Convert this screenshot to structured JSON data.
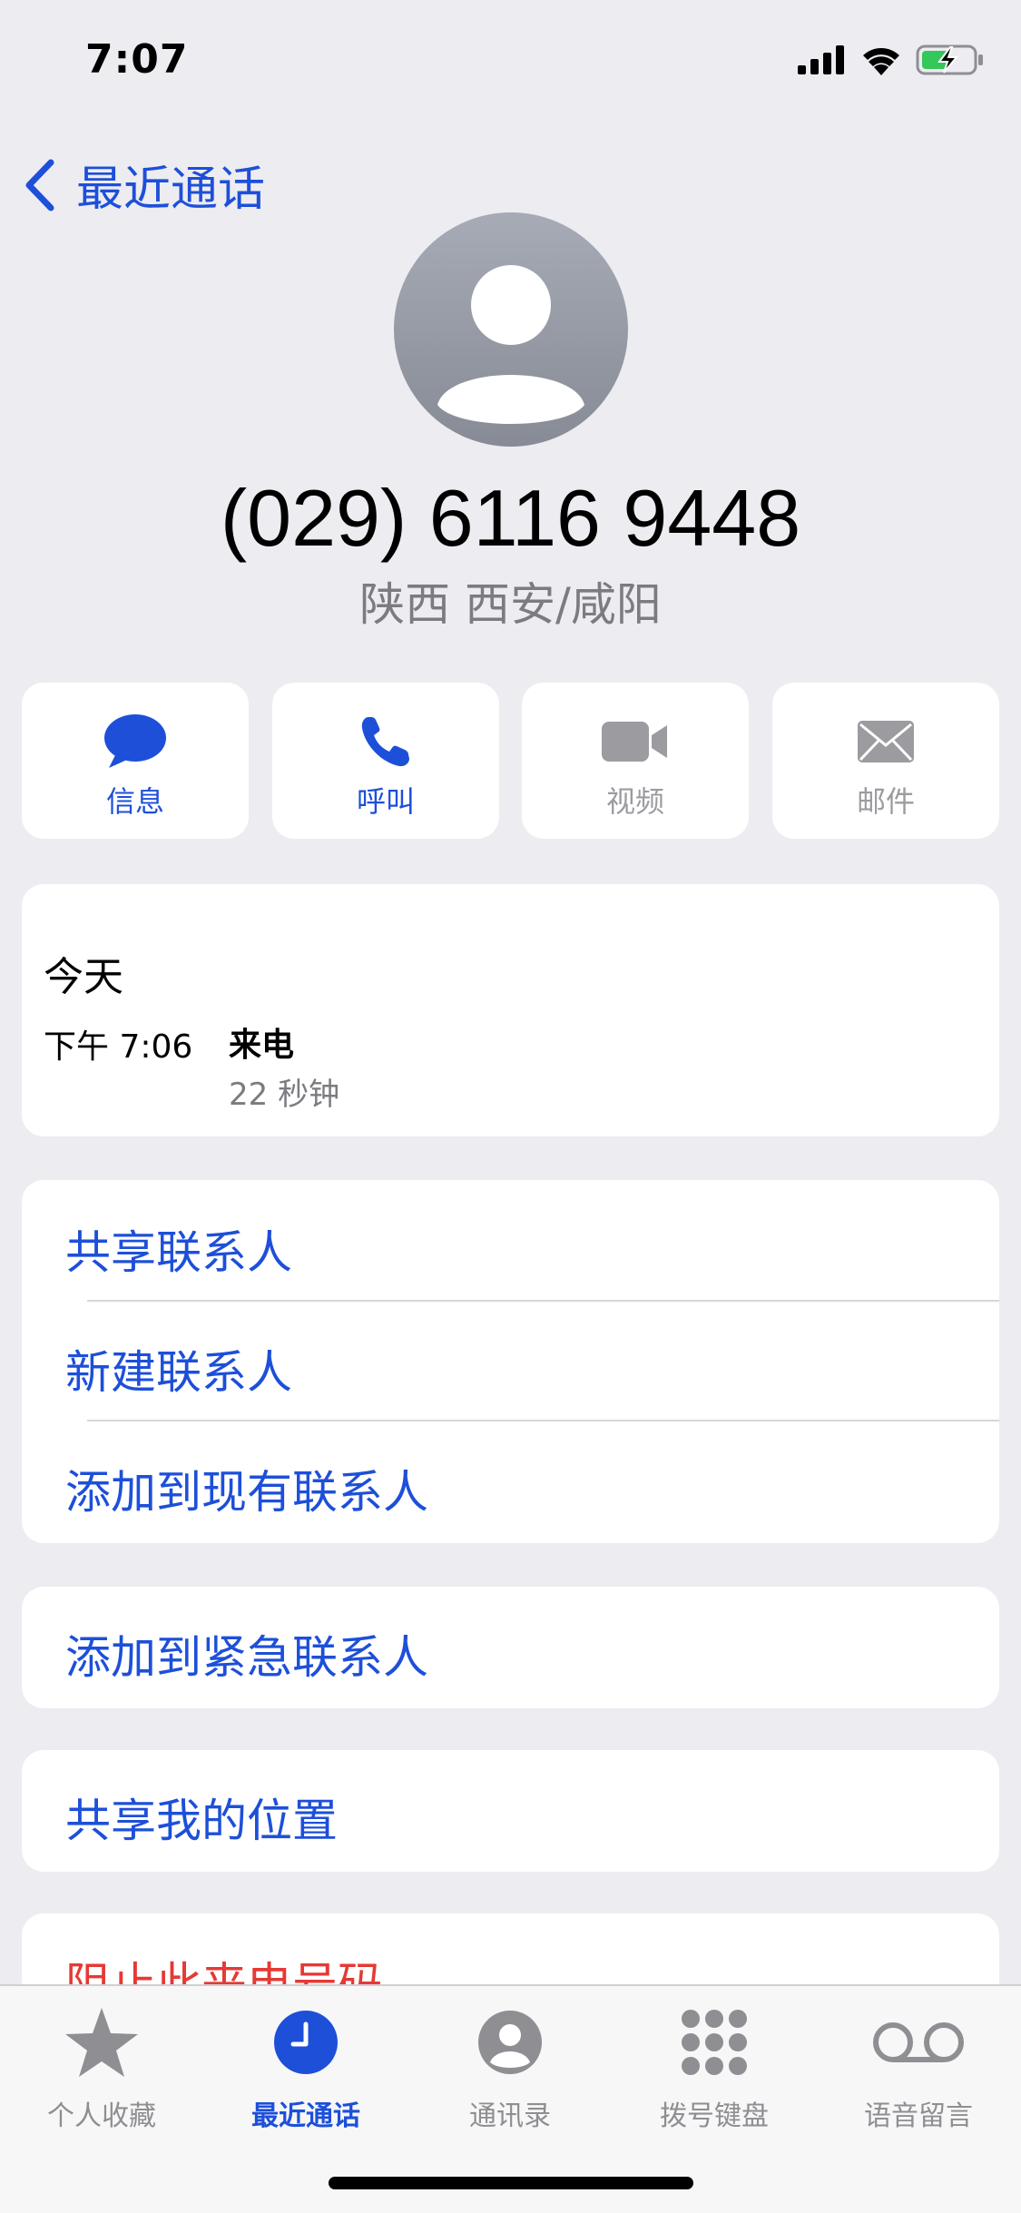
{
  "status_bar": {
    "time": "7:07"
  },
  "nav": {
    "back_label": "最近通话"
  },
  "contact": {
    "phone": "(029) 6116 9448",
    "location": "陕西 西安/咸阳"
  },
  "actions": [
    {
      "label": "信息",
      "icon": "message-bubble-icon",
      "enabled": true
    },
    {
      "label": "呼叫",
      "icon": "phone-icon",
      "enabled": true
    },
    {
      "label": "视频",
      "icon": "video-camera-icon",
      "enabled": false
    },
    {
      "label": "邮件",
      "icon": "mail-icon",
      "enabled": false
    }
  ],
  "history": {
    "day": "今天",
    "time": "下午 7:06",
    "type": "来电",
    "duration": "22 秒钟"
  },
  "contact_options": [
    "共享联系人",
    "新建联系人",
    "添加到现有联系人"
  ],
  "emergency_option": "添加到紧急联系人",
  "location_option": "共享我的位置",
  "block_option": "阻止此来电号码",
  "tabs": [
    {
      "label": "个人收藏",
      "icon": "star-icon",
      "active": false
    },
    {
      "label": "最近通话",
      "icon": "clock-icon",
      "active": true
    },
    {
      "label": "通讯录",
      "icon": "contacts-icon",
      "active": false
    },
    {
      "label": "拨号键盘",
      "icon": "keypad-icon",
      "active": false
    },
    {
      "label": "语音留言",
      "icon": "voicemail-icon",
      "active": false
    }
  ],
  "colors": {
    "accent": "#1d4fd9",
    "destructive": "#e53935",
    "secondary_text": "#7b7b80"
  }
}
